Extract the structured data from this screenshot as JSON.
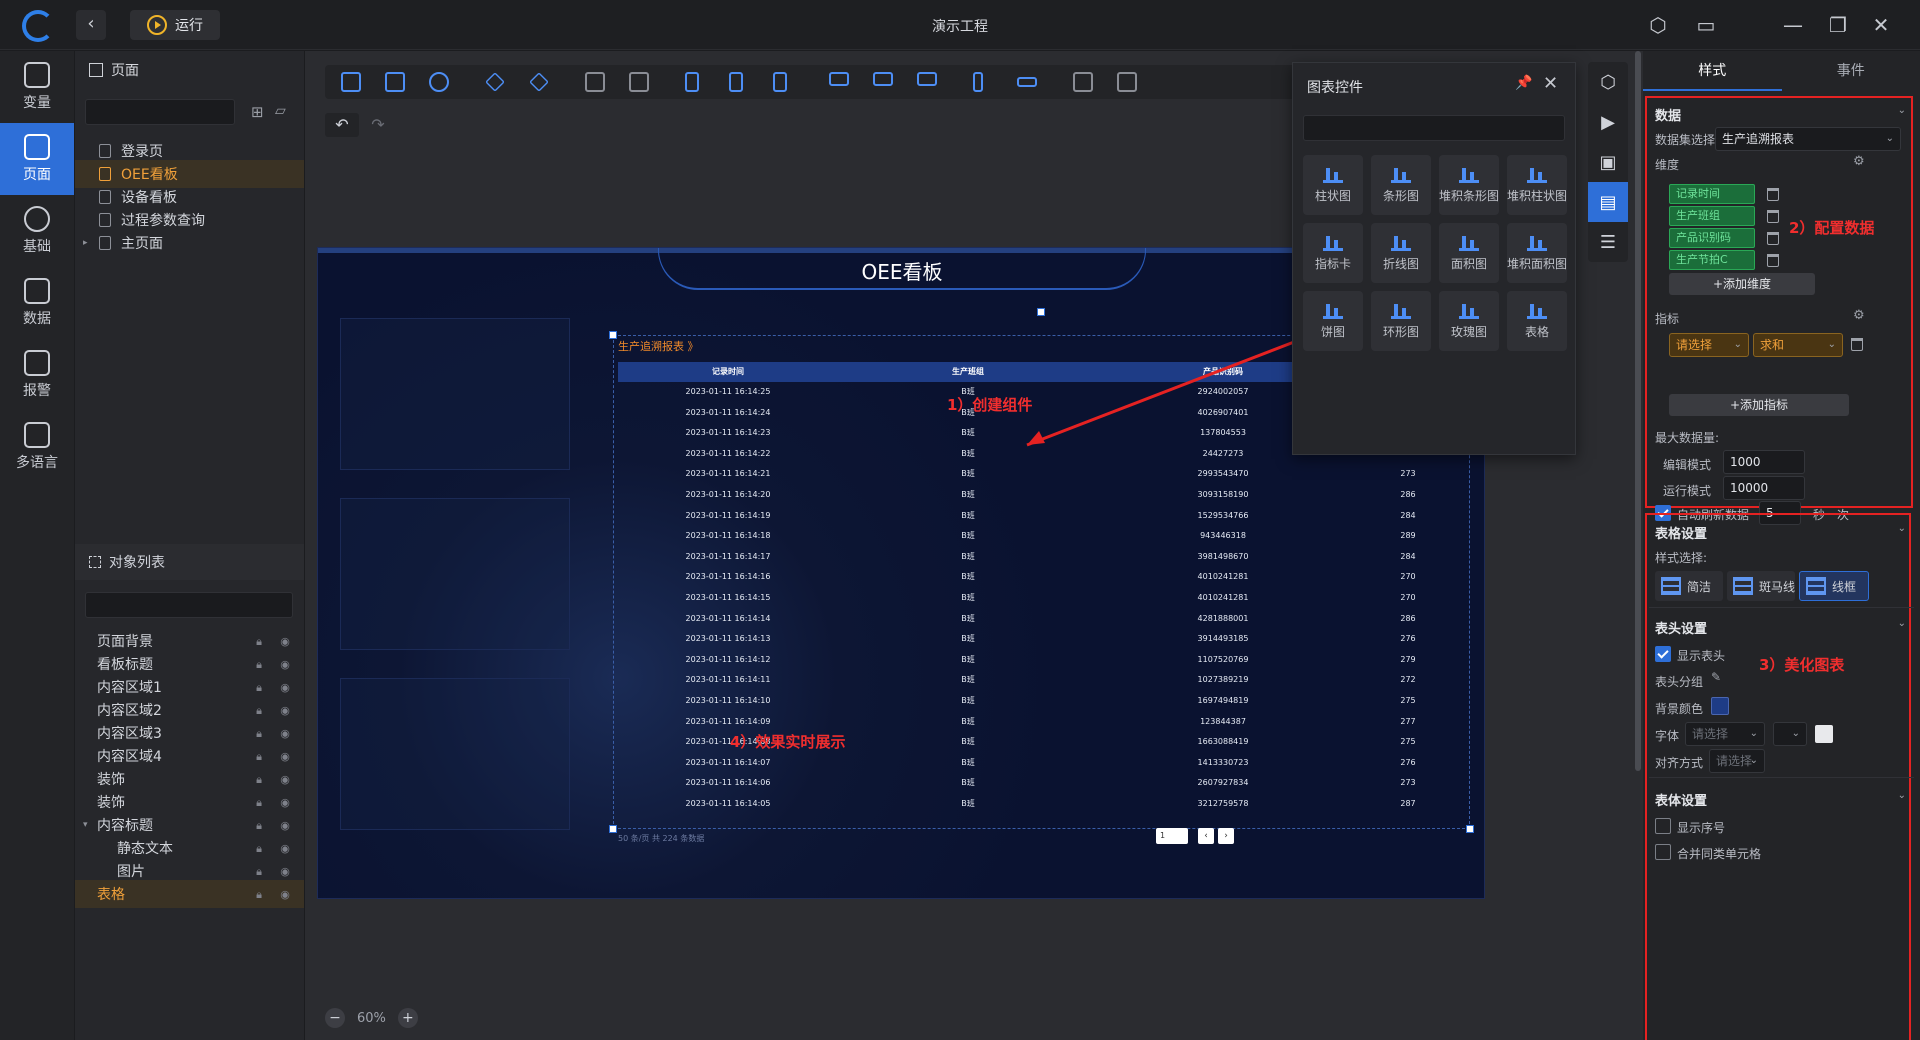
{
  "app": {
    "title": "演示工程",
    "run_label": "运行"
  },
  "left_nav": [
    {
      "label": "变量"
    },
    {
      "label": "页面"
    },
    {
      "label": "基础"
    },
    {
      "label": "数据"
    },
    {
      "label": "报警"
    },
    {
      "label": "多语言"
    }
  ],
  "pages_panel": {
    "title": "页面",
    "items": [
      "登录页",
      "OEE看板",
      "设备看板",
      "过程参数查询",
      "主页面"
    ]
  },
  "object_panel": {
    "title": "对象列表",
    "items": [
      "页面背景",
      "看板标题",
      "内容区域1",
      "内容区域2",
      "内容区域3",
      "内容区域4",
      "装饰",
      "装饰",
      "内容标题",
      "静态文本",
      "图片",
      "表格"
    ]
  },
  "board": {
    "title": "OEE看板",
    "table_title": "生产追溯报表 》",
    "headers": [
      "记录时间",
      "生产班组",
      "产品识别码",
      ""
    ],
    "rows": [
      [
        "2023-01-11 16:14:25",
        "B班",
        "2924002057",
        ""
      ],
      [
        "2023-01-11 16:14:24",
        "B班",
        "4026907401",
        ""
      ],
      [
        "2023-01-11 16:14:23",
        "B班",
        "137804553",
        ""
      ],
      [
        "2023-01-11 16:14:22",
        "B班",
        "24427273",
        ""
      ],
      [
        "2023-01-11 16:14:21",
        "B班",
        "2993543470",
        "273"
      ],
      [
        "2023-01-11 16:14:20",
        "B班",
        "3093158190",
        "286"
      ],
      [
        "2023-01-11 16:14:19",
        "B班",
        "1529534766",
        "284"
      ],
      [
        "2023-01-11 16:14:18",
        "B班",
        "943446318",
        "289"
      ],
      [
        "2023-01-11 16:14:17",
        "B班",
        "3981498670",
        "284"
      ],
      [
        "2023-01-11 16:14:16",
        "B班",
        "4010241281",
        "270"
      ],
      [
        "2023-01-11 16:14:15",
        "B班",
        "4010241281",
        "270"
      ],
      [
        "2023-01-11 16:14:14",
        "B班",
        "4281888001",
        "286"
      ],
      [
        "2023-01-11 16:14:13",
        "B班",
        "3914493185",
        "276"
      ],
      [
        "2023-01-11 16:14:12",
        "B班",
        "1107520769",
        "279"
      ],
      [
        "2023-01-11 16:14:11",
        "B班",
        "1027389219",
        "272"
      ],
      [
        "2023-01-11 16:14:10",
        "B班",
        "1697494819",
        "275"
      ],
      [
        "2023-01-11 16:14:09",
        "B班",
        "123844387",
        "277"
      ],
      [
        "2023-01-11 16:14:08",
        "B班",
        "1663088419",
        "275"
      ],
      [
        "2023-01-11 16:14:07",
        "B班",
        "1413330723",
        "276"
      ],
      [
        "2023-01-11 16:14:06",
        "B班",
        "2607927834",
        "273"
      ],
      [
        "2023-01-11 16:14:05",
        "B班",
        "3212759578",
        "287"
      ]
    ],
    "footer": "50 条/页  共 224 条数据",
    "page_num": "1"
  },
  "annotations": {
    "a1": "1）创建组件",
    "a2": "2）配置数据",
    "a3": "3）美化图表",
    "a4": "4）效果实时展示"
  },
  "zoom": "60%",
  "chart_popup": {
    "title": "图表控件",
    "items": [
      "柱状图",
      "条形图",
      "堆积条形图",
      "堆积柱状图",
      "指标卡",
      "折线图",
      "面积图",
      "堆积面积图",
      "饼图",
      "环形图",
      "玫瑰图",
      "表格"
    ]
  },
  "right_panel": {
    "tabs": [
      "样式",
      "事件"
    ],
    "data_section": {
      "title": "数据",
      "dataset_label": "数据集选择",
      "dataset_value": "生产追溯报表",
      "dimension_label": "维度",
      "dimensions": [
        "记录时间",
        "生产班组",
        "产品识别码",
        "生产节拍C"
      ],
      "add_dimension": "+添加维度",
      "metric_label": "指标",
      "metric_select": "请选择",
      "metric_agg": "求和",
      "add_metric": "+添加指标",
      "max_label": "最大数据量:",
      "edit_label": "编辑模式",
      "edit_value": "1000",
      "run_label": "运行模式",
      "run_value": "10000",
      "auto_refresh": "自动刷新数据",
      "refresh_value": "5",
      "refresh_unit": "秒一次"
    },
    "table_settings": {
      "title": "表格设置",
      "style_label": "样式选择:",
      "styles": [
        "简洁",
        "斑马线",
        "线框"
      ]
    },
    "header_settings": {
      "title": "表头设置",
      "show_header": "显示表头",
      "group": "表头分组",
      "bg_color_label": "背景颜色",
      "bg_color": "#1e3c86",
      "font_label": "字体",
      "font_placeholder": "请选择",
      "align_label": "对齐方式",
      "align_placeholder": "请选择"
    },
    "body_settings": {
      "title": "表体设置",
      "show_index": "显示序号",
      "merge_cells": "合并同类单元格"
    }
  },
  "colors": {
    "accent": "#2e6fd8",
    "highlight": "#f0a03a",
    "annotation": "#e52222"
  }
}
